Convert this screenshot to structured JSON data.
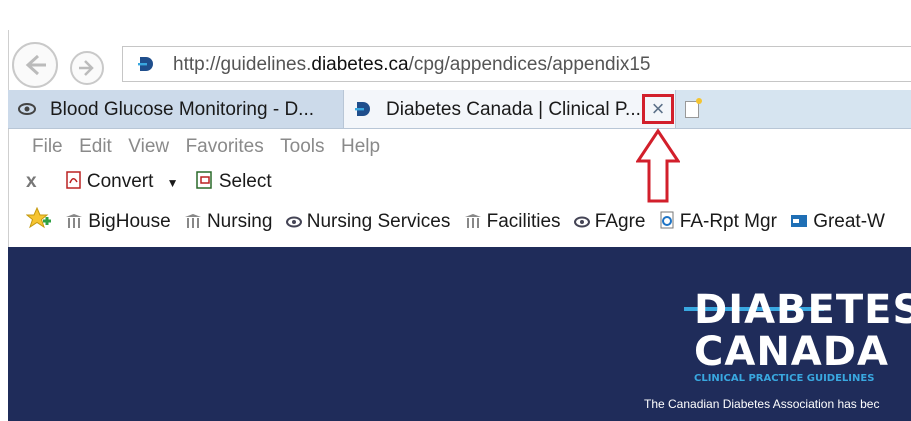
{
  "browser": {
    "address": {
      "prefix": "http://guidelines.",
      "domain": "diabetes.ca",
      "path": "/cpg/appendices/appendix15"
    },
    "tabs": [
      {
        "label": "Blood Glucose Monitoring - D..."
      },
      {
        "label": "Diabetes Canada | Clinical P..."
      }
    ],
    "close_glyph": "×",
    "menu": [
      "File",
      "Edit",
      "View",
      "Favorites",
      "Tools",
      "Help"
    ],
    "toolbar": {
      "close_x": "x",
      "convert": "Convert",
      "select": "Select"
    },
    "favorites": [
      "BigHouse",
      "Nursing",
      "Nursing Services",
      "Facilities",
      "FAgre",
      "FA-Rpt Mgr",
      "Great-W"
    ]
  },
  "page": {
    "logo_line1": "DIABETES",
    "logo_line2": "CANADA",
    "logo_sub": "CLINICAL PRACTICE GUIDELINES",
    "banner_text": "The Canadian Diabetes Association has bec"
  },
  "colors": {
    "banner": "#1f2c5a",
    "accent": "#39a8e0",
    "highlight": "#d21f2b"
  }
}
